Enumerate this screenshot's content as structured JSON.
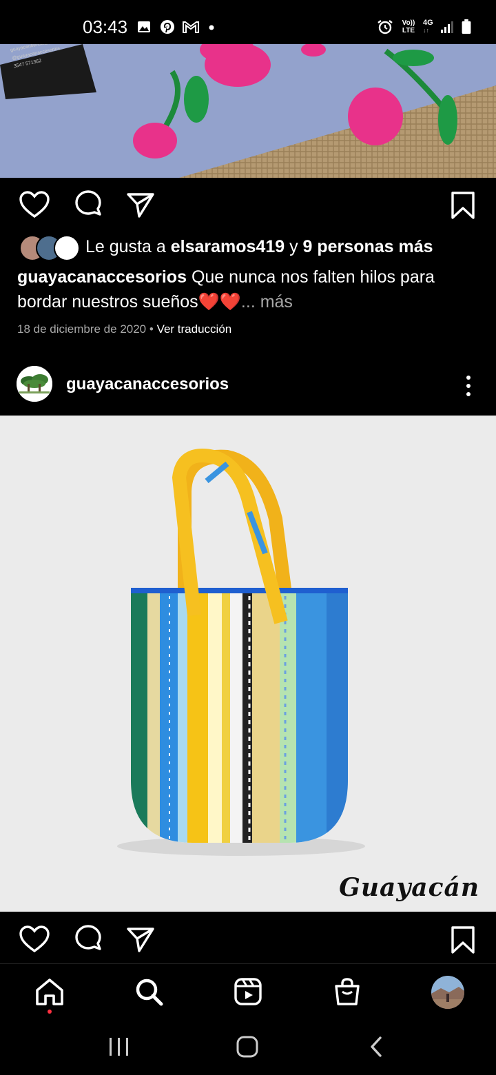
{
  "status_bar": {
    "time": "03:43",
    "left_icons": [
      "image-icon",
      "pinterest-icon",
      "gmail-icon",
      "dot-icon"
    ],
    "right_icons": [
      "alarm-icon",
      "volte-icon",
      "4g-icon",
      "signal-icon",
      "battery-icon"
    ],
    "volte_label_top": "Vo))",
    "volte_label_bottom": "LTE",
    "net_label": "4G"
  },
  "post1": {
    "actions": [
      "like-icon",
      "comment-icon",
      "share-icon",
      "bookmark-icon"
    ],
    "likes_prefix": "Le gusta a",
    "likes_user": "elsaramos419",
    "likes_joiner": "y",
    "likes_others": "9 personas más",
    "caption_user": "guayacanaccesorios",
    "caption_text": "Que nunca nos falten hilos para bordar nuestros sueños❤️❤️",
    "caption_more": "... más",
    "date": "18 de diciembre de 2020",
    "translate": "Ver traducción",
    "photo_card_lines": [
      "guayacantienda@gmail.com",
      "@guayacanaccesorios",
      "3547 571362"
    ]
  },
  "post2": {
    "username": "guayacanaccesorios",
    "watermark": "Guayacán",
    "actions": [
      "like-icon",
      "comment-icon",
      "share-icon",
      "bookmark-icon"
    ]
  },
  "bottom_nav": {
    "items": [
      "home-icon",
      "search-icon",
      "reels-icon",
      "shop-icon",
      "profile-avatar"
    ],
    "active": "home-icon",
    "notification_color": "#ff3040"
  },
  "system_nav": [
    "recents-button",
    "home-button",
    "back-button"
  ]
}
